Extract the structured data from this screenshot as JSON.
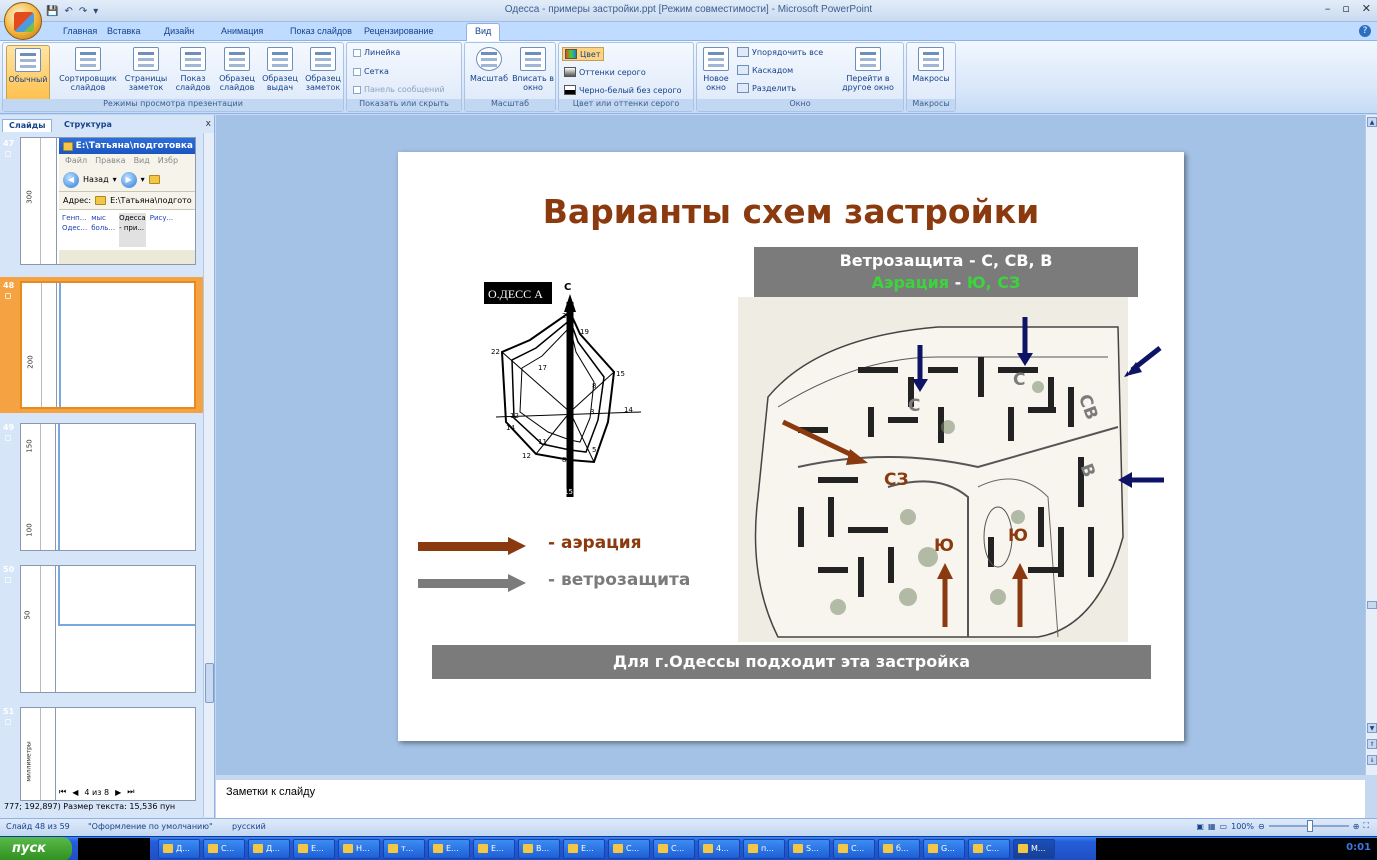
{
  "window": {
    "title": "Одесса - примеры застройки.ppt [Режим совместимости] - Microsoft PowerPoint",
    "controls": [
      "–",
      "▫",
      "✕"
    ]
  },
  "ribbon_tabs": [
    {
      "label": "Главная",
      "active": false
    },
    {
      "label": "Вставка",
      "active": false
    },
    {
      "label": "Дизайн",
      "active": false
    },
    {
      "label": "Анимация",
      "active": false
    },
    {
      "label": "Показ слайдов",
      "active": false
    },
    {
      "label": "Рецензирование",
      "active": false
    },
    {
      "label": "Вид",
      "active": true
    }
  ],
  "ribbon": {
    "views_group": {
      "label": "Режимы просмотра презентации",
      "buttons": [
        {
          "label": "Обычный",
          "active": true
        },
        {
          "label": "Сортировщик слайдов",
          "active": false
        },
        {
          "label": "Страницы заметок",
          "active": false
        },
        {
          "label": "Показ слайдов",
          "active": false
        },
        {
          "label": "Образец слайдов",
          "active": false
        },
        {
          "label": "Образец выдач",
          "active": false
        },
        {
          "label": "Образец заметок",
          "active": false
        }
      ]
    },
    "show_group": {
      "label": "Показать или скрыть",
      "items": [
        {
          "label": "Линейка",
          "enabled": true
        },
        {
          "label": "Сетка",
          "enabled": true
        },
        {
          "label": "Панель сообщений",
          "enabled": false
        }
      ]
    },
    "zoom_group": {
      "label": "Масштаб",
      "buttons": [
        {
          "label": "Масштаб"
        },
        {
          "label": "Вписать в окно"
        }
      ]
    },
    "color_group": {
      "label": "Цвет или оттенки серого",
      "items": [
        {
          "label": "Цвет",
          "active": true
        },
        {
          "label": "Оттенки серого",
          "active": false
        },
        {
          "label": "Черно-белый без серого",
          "active": false
        }
      ]
    },
    "window_group": {
      "label": "Окно",
      "new_window": "Новое окно",
      "items": [
        "Упорядочить все",
        "Каскадом",
        "Разделить"
      ],
      "switch": "Перейти в другое окно"
    },
    "macros_group": {
      "label": "Макросы",
      "button": "Макросы"
    }
  },
  "slide_panel": {
    "tabs": [
      {
        "label": "Слайды",
        "active": true
      },
      {
        "label": "Структура",
        "active": false
      }
    ],
    "close": "x",
    "thumbnails": [
      {
        "number": "47",
        "ruler": "300",
        "selected": false
      },
      {
        "number": "48",
        "ruler": "200",
        "selected": true
      },
      {
        "number": "49",
        "ruler": "150",
        "ruler2": "100",
        "selected": false
      },
      {
        "number": "50",
        "ruler": "50",
        "selected": false
      },
      {
        "number": "51",
        "ruler": "миллиметры",
        "selected": false
      }
    ],
    "explorer": {
      "title": "E:\\Татьяна\\подготовка",
      "menu": [
        "Файл",
        "Правка",
        "Вид",
        "Избр"
      ],
      "back": "Назад",
      "address_label": "Адрес:",
      "address": "E:\\Татьяна\\подгото",
      "files": [
        {
          "line1": "Генп...",
          "line2": "Одес...",
          "selected": false
        },
        {
          "line1": "мыс",
          "line2": "боль...",
          "selected": false
        },
        {
          "line1": "Одесса",
          "line2": "- при...",
          "selected": true
        },
        {
          "line1": "Рису...",
          "line2": "",
          "selected": false
        }
      ]
    },
    "page_counter": "4 из 8",
    "status_text": "777; 192,897)  Размер текста: 15,536 пун"
  },
  "slide": {
    "title": "Варианты схем застройки",
    "wind_line1": "Ветрозащита - С, СВ, В",
    "aeration_word": "Аэрация",
    "aeration_dash": " - ",
    "aeration_dirs": "Ю, СЗ",
    "windrose_label": "О.ДЕСС А",
    "windrose_north": "С",
    "windrose_numbers": [
      "22",
      "19",
      "22",
      "17",
      "15",
      "8",
      "12",
      "3",
      "14",
      "14",
      "11",
      "5",
      "12",
      "8",
      "15"
    ],
    "legend_aeration": "- аэрация",
    "legend_wind": "- ветрозащита",
    "map_labels": {
      "north": "С",
      "north2": "С",
      "northeast": "СВ",
      "east": "В",
      "northwest": "СЗ",
      "south1": "Ю",
      "south2": "Ю"
    },
    "bottom_caption": "Для г.Одессы подходит   эта застройка",
    "colors": {
      "title": "#8b3a10",
      "aeration_arrow": "#8b3a10",
      "wind_arrow": "#7b7b7b",
      "green": "#3cd43c",
      "navy_arrow": "#0d1466"
    }
  },
  "notes": {
    "placeholder": "Заметки к слайду"
  },
  "statusbar": {
    "slide_info": "Слайд 48 из 59",
    "theme": "\"Оформление по умолчанию\"",
    "language": "русский",
    "zoom": "100%"
  },
  "taskbar": {
    "start": "пуск",
    "buttons": [
      {
        "label": "Д..."
      },
      {
        "label": "С..."
      },
      {
        "label": "Д..."
      },
      {
        "label": "E..."
      },
      {
        "label": "Н..."
      },
      {
        "label": "т..."
      },
      {
        "label": "E..."
      },
      {
        "label": "E..."
      },
      {
        "label": "В..."
      },
      {
        "label": "E..."
      },
      {
        "label": "С..."
      },
      {
        "label": "С..."
      },
      {
        "label": "4..."
      },
      {
        "label": "п..."
      },
      {
        "label": "S..."
      },
      {
        "label": "С..."
      },
      {
        "label": "б..."
      },
      {
        "label": "G..."
      },
      {
        "label": "С..."
      },
      {
        "label": "М...",
        "active": true
      }
    ],
    "clock": "0:01"
  }
}
